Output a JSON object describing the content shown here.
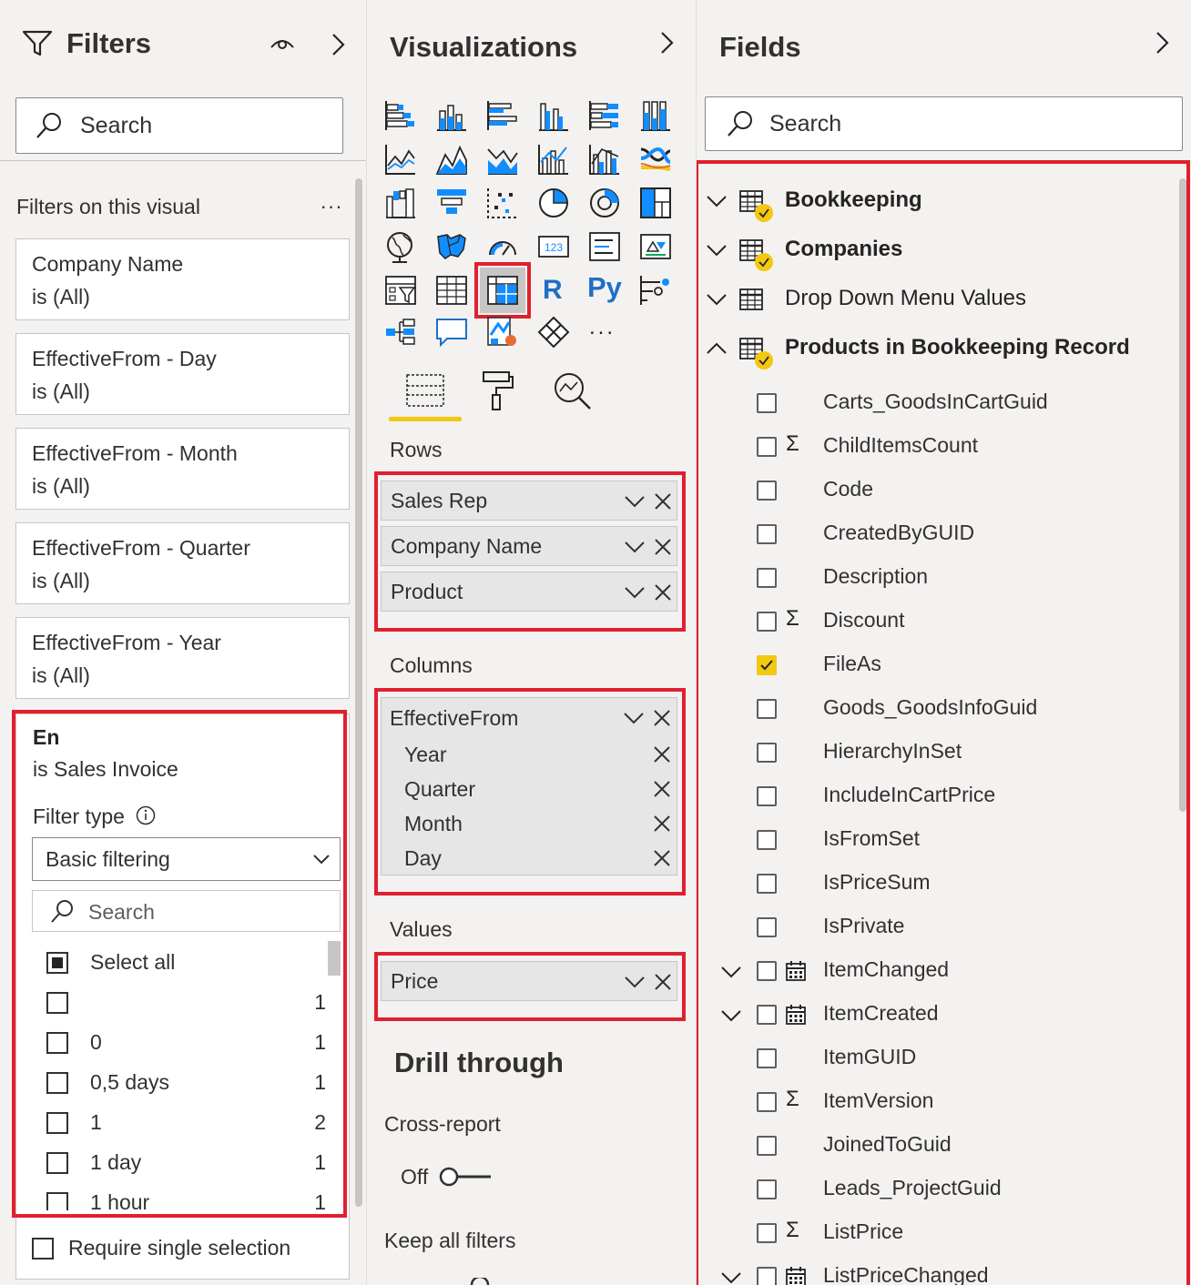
{
  "filters": {
    "title": "Filters",
    "search_placeholder": "Search",
    "section_label": "Filters on this visual",
    "more": "...",
    "cards": [
      {
        "name": "Company Name",
        "value": "is (All)"
      },
      {
        "name": "EffectiveFrom - Day",
        "value": "is (All)"
      },
      {
        "name": "EffectiveFrom - Month",
        "value": "is (All)"
      },
      {
        "name": "EffectiveFrom - Quarter",
        "value": "is (All)"
      },
      {
        "name": "EffectiveFrom - Year",
        "value": "is (All)"
      }
    ],
    "expanded": {
      "name": "En",
      "value": "is Sales Invoice",
      "filter_type_label": "Filter type",
      "filter_type_value": "Basic filtering",
      "search_placeholder": "Search",
      "select_all": "Select all",
      "items": [
        {
          "label": "",
          "count": "1"
        },
        {
          "label": "0",
          "count": "1"
        },
        {
          "label": "0,5 days",
          "count": "1"
        },
        {
          "label": "1",
          "count": "2"
        },
        {
          "label": "1 day",
          "count": "1"
        },
        {
          "label": "1 hour",
          "count": "1"
        }
      ]
    },
    "require_single": "Require single selection"
  },
  "visualizations": {
    "title": "Visualizations",
    "rows_label": "Rows",
    "rows": [
      "Sales Rep",
      "Company Name",
      "Product"
    ],
    "columns_label": "Columns",
    "column_field": "EffectiveFrom",
    "column_levels": [
      "Year",
      "Quarter",
      "Month",
      "Day"
    ],
    "values_label": "Values",
    "values": [
      "Price"
    ],
    "drill_through": "Drill through",
    "cross_report": "Cross-report",
    "toggle_state": "Off",
    "keep_filters": "Keep all filters",
    "more": "...",
    "r_label": "R",
    "py_label": "Py",
    "card_label": "123"
  },
  "fields": {
    "title": "Fields",
    "search_placeholder": "Search",
    "tables": [
      {
        "name": "Bookkeeping",
        "bold": true,
        "expanded": false
      },
      {
        "name": "Companies",
        "bold": true,
        "expanded": false
      },
      {
        "name": "Drop Down Menu Values",
        "bold": false,
        "expanded": false
      },
      {
        "name": "Products in Bookkeeping Record",
        "bold": true,
        "expanded": true
      }
    ],
    "items": [
      {
        "name": "Carts_GoodsInCartGuid",
        "type": "text",
        "checked": false
      },
      {
        "name": "ChildItemsCount",
        "type": "sum",
        "checked": false
      },
      {
        "name": "Code",
        "type": "text",
        "checked": false
      },
      {
        "name": "CreatedByGUID",
        "type": "text",
        "checked": false
      },
      {
        "name": "Description",
        "type": "text",
        "checked": false
      },
      {
        "name": "Discount",
        "type": "sum",
        "checked": false
      },
      {
        "name": "FileAs",
        "type": "text",
        "checked": true
      },
      {
        "name": "Goods_GoodsInfoGuid",
        "type": "text",
        "checked": false
      },
      {
        "name": "HierarchyInSet",
        "type": "text",
        "checked": false
      },
      {
        "name": "IncludeInCartPrice",
        "type": "text",
        "checked": false
      },
      {
        "name": "IsFromSet",
        "type": "text",
        "checked": false
      },
      {
        "name": "IsPriceSum",
        "type": "text",
        "checked": false
      },
      {
        "name": "IsPrivate",
        "type": "text",
        "checked": false
      },
      {
        "name": "ItemChanged",
        "type": "date",
        "checked": false
      },
      {
        "name": "ItemCreated",
        "type": "date",
        "checked": false
      },
      {
        "name": "ItemGUID",
        "type": "text",
        "checked": false
      },
      {
        "name": "ItemVersion",
        "type": "sum",
        "checked": false
      },
      {
        "name": "JoinedToGuid",
        "type": "text",
        "checked": false
      },
      {
        "name": "Leads_ProjectGuid",
        "type": "text",
        "checked": false
      },
      {
        "name": "ListPrice",
        "type": "sum",
        "checked": false
      },
      {
        "name": "ListPriceChanged",
        "type": "date",
        "checked": false
      }
    ]
  },
  "colors": {
    "highlight": "#e0202f",
    "accent": "#f2c811",
    "check": "#f2c811"
  }
}
